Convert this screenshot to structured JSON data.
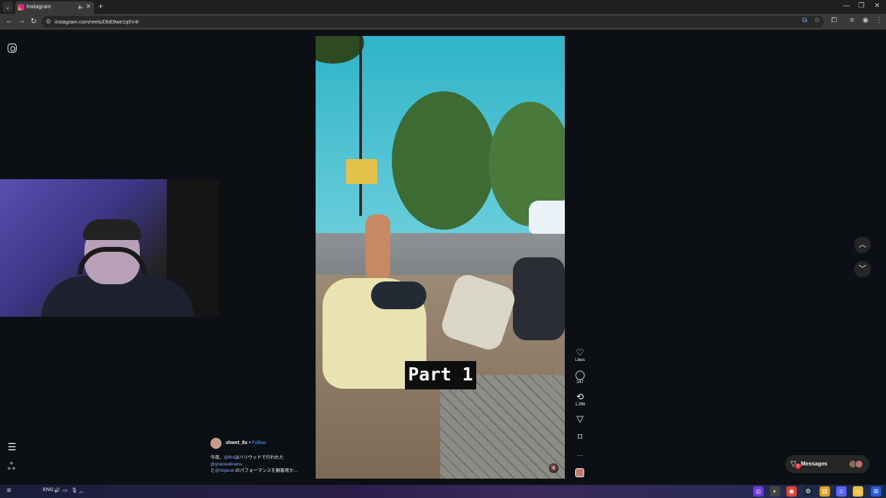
{
  "browser": {
    "tab_title": "Instagram",
    "tab_close": "✕",
    "new_tab": "+",
    "url": "instagram.com/reels/DbE9we1q5V4/",
    "window_controls": [
      "—",
      "❐",
      "✕"
    ]
  },
  "reel": {
    "overlay_text": "Part 1",
    "actions": [
      {
        "icon": "heart-icon",
        "glyph": "♡",
        "label": "Likes"
      },
      {
        "icon": "comment-icon",
        "glyph": "◯",
        "label": "247"
      },
      {
        "icon": "repost-icon",
        "glyph": "⟲",
        "label": "1,266"
      },
      {
        "icon": "share-icon",
        "glyph": "▽",
        "label": ""
      },
      {
        "icon": "save-icon",
        "glyph": "⌑",
        "label": ""
      },
      {
        "icon": "more-icon",
        "glyph": "···",
        "label": ""
      }
    ]
  },
  "caption": {
    "username": "shwet_8x",
    "separator": " • ",
    "follow": "Follow",
    "line1_pre": "今夜、",
    "mention1": "@thv",
    "line1_post": "はハリウッドで行われた",
    "mention2": "@gracieabrams",
    "line3_pre": "と",
    "mention3": "@dojacat",
    "line3_post": " のパフォーマンスを観客席か..."
  },
  "nav": {
    "up": "︿",
    "down": "﹀"
  },
  "messages": {
    "label": "Messages",
    "badge": "2"
  },
  "taskbar": {
    "lang": "ENG"
  }
}
